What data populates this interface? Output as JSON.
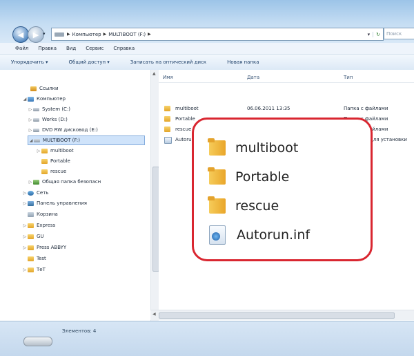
{
  "address_bar": {
    "segments": [
      "Компьютер",
      "MULTIBOOT (F:)"
    ],
    "search_placeholder": "Поиск"
  },
  "menu": [
    "Файл",
    "Правка",
    "Вид",
    "Сервис",
    "Справка"
  ],
  "commands": [
    "Упорядочить ▾",
    "Общий доступ ▾",
    "Записать на оптический диск",
    "Новая папка"
  ],
  "nav_tree": [
    {
      "label": "Ссылки",
      "icon": "folder-icon",
      "selected": false
    },
    {
      "label": "Компьютер",
      "icon": "computer-icon",
      "selected": false
    },
    {
      "label": "System (C:)",
      "icon": "drive-icon",
      "selected": false
    },
    {
      "label": "Works (D:)",
      "icon": "drive-icon",
      "selected": false
    },
    {
      "label": "DVD RW дисковод (E:)",
      "icon": "drive-icon",
      "selected": false
    },
    {
      "label": "MULTIBOOT (F:)",
      "icon": "drive-icon",
      "selected": true
    },
    {
      "label": "multiboot",
      "icon": "folder-icon",
      "selected": false
    },
    {
      "label": "Portable",
      "icon": "folder-icon",
      "selected": false
    },
    {
      "label": "rescue",
      "icon": "folder-icon",
      "selected": false
    },
    {
      "label": "Общая папка безопасн",
      "icon": "shared-folder-icon",
      "selected": false
    },
    {
      "label": "Сеть",
      "icon": "network-icon",
      "selected": false
    },
    {
      "label": "Панель управления",
      "icon": "control-panel-icon",
      "selected": false
    },
    {
      "label": "Корзина",
      "icon": "recycle-bin-icon",
      "selected": false
    },
    {
      "label": "Express",
      "icon": "folder-icon",
      "selected": false
    },
    {
      "label": "GU",
      "icon": "folder-icon",
      "selected": false
    },
    {
      "label": "Press ABBYY",
      "icon": "folder-icon",
      "selected": false
    },
    {
      "label": "Test",
      "icon": "folder-icon",
      "selected": false
    },
    {
      "label": "ТеТ",
      "icon": "folder-icon",
      "selected": false
    }
  ],
  "columns": [
    "Имя",
    "Дата",
    "Тип"
  ],
  "files": [
    {
      "name": "multiboot",
      "date": "06.06.2011 13:35",
      "type": "Папка с файлами",
      "icon": "folder-icon"
    },
    {
      "name": "Portable",
      "date": "",
      "type": "Папка с файлами",
      "icon": "folder-icon"
    },
    {
      "name": "rescue",
      "date": "",
      "type": "Папка с файлами",
      "icon": "folder-icon"
    },
    {
      "name": "Autorun.inf",
      "date": "",
      "type": "Сведения для установки",
      "icon": "settings-file-icon"
    }
  ],
  "callout": {
    "items": [
      {
        "label": "multiboot",
        "icon": "folder-icon"
      },
      {
        "label": "Portable",
        "icon": "folder-icon"
      },
      {
        "label": "rescue",
        "icon": "folder-icon"
      },
      {
        "label": "Autorun.inf",
        "icon": "settings-file-icon"
      }
    ]
  },
  "status": {
    "text": "Элементов: 4"
  }
}
